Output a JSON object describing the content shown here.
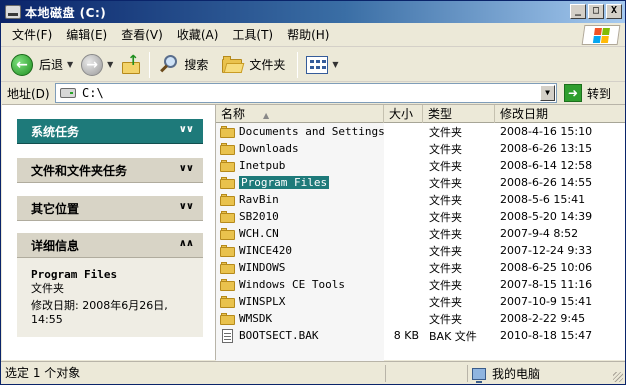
{
  "window": {
    "title": "本地磁盘 (C:)",
    "controls": {
      "minimize": "_",
      "maximize": "□",
      "close": "X"
    }
  },
  "menubar": {
    "items": [
      "文件(F)",
      "编辑(E)",
      "查看(V)",
      "收藏(A)",
      "工具(T)",
      "帮助(H)"
    ]
  },
  "toolbar": {
    "back_label": "后退",
    "search_label": "搜索",
    "folders_label": "文件夹"
  },
  "address": {
    "label": "地址(D)",
    "value": "C:\\",
    "go_label": "转到"
  },
  "tasks": {
    "system": "系统任务",
    "file_folder": "文件和文件夹任务",
    "other_places": "其它位置",
    "details": {
      "header": "详细信息",
      "name": "Program Files",
      "type": "文件夹",
      "modified_label": "修改日期: 2008年6月26日,",
      "modified_time": "14:55"
    }
  },
  "columns": {
    "name": "名称",
    "size": "大小",
    "type": "类型",
    "date": "修改日期"
  },
  "files": [
    {
      "name": "Documents and Settings",
      "size": "",
      "type": "文件夹",
      "date": "2008-4-16 15:10",
      "kind": "folder"
    },
    {
      "name": "Downloads",
      "size": "",
      "type": "文件夹",
      "date": "2008-6-26 13:15",
      "kind": "folder"
    },
    {
      "name": "Inetpub",
      "size": "",
      "type": "文件夹",
      "date": "2008-6-14 12:58",
      "kind": "folder"
    },
    {
      "name": "Program Files",
      "size": "",
      "type": "文件夹",
      "date": "2008-6-26 14:55",
      "kind": "folder",
      "selected": true
    },
    {
      "name": "RavBin",
      "size": "",
      "type": "文件夹",
      "date": "2008-5-6 15:41",
      "kind": "folder"
    },
    {
      "name": "SB2010",
      "size": "",
      "type": "文件夹",
      "date": "2008-5-20 14:39",
      "kind": "folder"
    },
    {
      "name": "WCH.CN",
      "size": "",
      "type": "文件夹",
      "date": "2007-9-4 8:52",
      "kind": "folder"
    },
    {
      "name": "WINCE420",
      "size": "",
      "type": "文件夹",
      "date": "2007-12-24 9:33",
      "kind": "folder"
    },
    {
      "name": "WINDOWS",
      "size": "",
      "type": "文件夹",
      "date": "2008-6-25 10:06",
      "kind": "folder"
    },
    {
      "name": "Windows CE Tools",
      "size": "",
      "type": "文件夹",
      "date": "2007-8-15 11:16",
      "kind": "folder"
    },
    {
      "name": "WINSPLX",
      "size": "",
      "type": "文件夹",
      "date": "2007-10-9 15:41",
      "kind": "folder"
    },
    {
      "name": "WMSDK",
      "size": "",
      "type": "文件夹",
      "date": "2008-2-22 9:45",
      "kind": "folder"
    },
    {
      "name": "BOOTSECT.BAK",
      "size": "8 KB",
      "type": "BAK 文件",
      "date": "2010-8-18 15:47",
      "kind": "file"
    }
  ],
  "status": {
    "selection": "选定 1 个对象",
    "location": "我的电脑"
  },
  "colors": {
    "title_start": "#0a246a",
    "title_end": "#a6caf0",
    "task_header": "#1e7a7a",
    "selection": "#1e7a7a"
  }
}
